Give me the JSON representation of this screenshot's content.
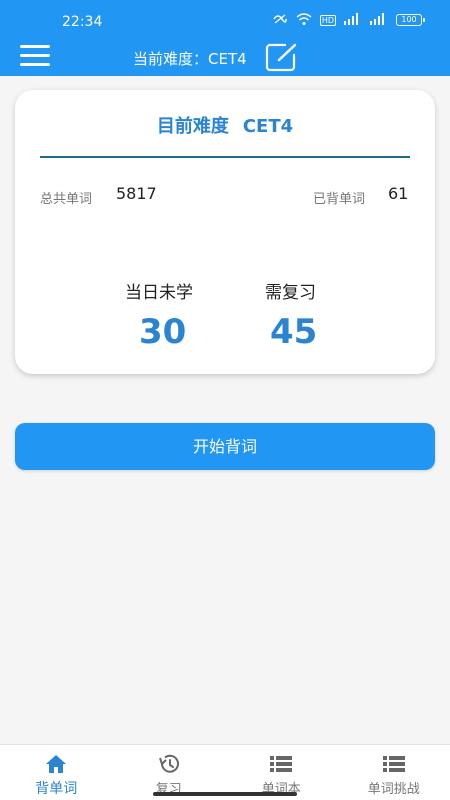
{
  "status": {
    "time": "22:34",
    "network_hd": "HD",
    "signal1": "5G",
    "signal2": "4G",
    "battery": "100"
  },
  "header": {
    "difficulty_label": "当前难度：CET4"
  },
  "card": {
    "title_label": "目前难度",
    "title_value": "CET4",
    "total_words_label": "总共单词",
    "total_words_value": "5817",
    "learned_label": "已背单词",
    "learned_value": "61",
    "unlearned_today_label": "当日未学",
    "unlearned_today_value": "30",
    "review_label": "需复习",
    "review_value": "45"
  },
  "start_button": "开始背词",
  "nav": {
    "items": [
      {
        "label": "背单词",
        "icon": "home-icon",
        "active": true
      },
      {
        "label": "复习",
        "icon": "history-icon",
        "active": false
      },
      {
        "label": "单词本",
        "icon": "list-icon",
        "active": false
      },
      {
        "label": "单词挑战",
        "icon": "list-icon",
        "active": false
      }
    ]
  },
  "colors": {
    "primary": "#2196f3",
    "accent_text": "#2a84d2",
    "divider": "#1e6d8a",
    "background": "#f5f5f5"
  }
}
